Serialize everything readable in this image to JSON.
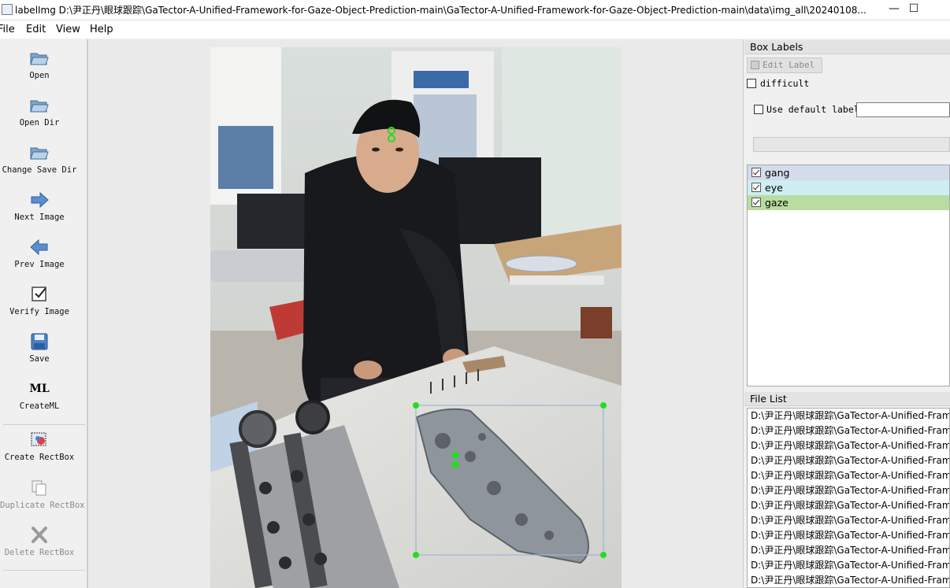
{
  "window": {
    "title": "labelImg D:\\尹正丹\\眼球跟踪\\GaTector-A-Unified-Framework-for-Gaze-Object-Prediction-main\\GaTector-A-Unified-Framework-for-Gaze-Object-Prediction-main\\data\\img_all\\20240108...",
    "minimize_glyph": "—",
    "maximize_glyph": "☐"
  },
  "menu": {
    "file": "File",
    "edit": "Edit",
    "view": "View",
    "help": "Help"
  },
  "toolbar": {
    "open": "Open",
    "open_dir": "Open Dir",
    "change_save_dir": "Change Save Dir",
    "next_image": "Next Image",
    "prev_image": "Prev Image",
    "verify_image": "Verify Image",
    "save": "Save",
    "create_ml": "CreateML",
    "create_rectbox": "Create RectBox",
    "duplicate_rectbox": "Duplicate RectBox",
    "delete_rectbox": "Delete RectBox",
    "ml_glyph": "ML"
  },
  "box_labels": {
    "title": "Box Labels",
    "edit_label": "Edit Label",
    "difficult": "difficult",
    "use_default_label": "Use default label",
    "default_label_value": "",
    "labels": [
      {
        "name": "gang",
        "checked": true,
        "color": "#d2dcea"
      },
      {
        "name": "eye",
        "checked": true,
        "color": "#cdeef2"
      },
      {
        "name": "gaze",
        "checked": true,
        "color": "#b9dca0"
      }
    ]
  },
  "file_list": {
    "title": "File List",
    "files": [
      "D:\\尹正丹\\眼球跟踪\\GaTector-A-Unified-Fram",
      "D:\\尹正丹\\眼球跟踪\\GaTector-A-Unified-Fram",
      "D:\\尹正丹\\眼球跟踪\\GaTector-A-Unified-Fram",
      "D:\\尹正丹\\眼球跟踪\\GaTector-A-Unified-Fram",
      "D:\\尹正丹\\眼球跟踪\\GaTector-A-Unified-Fram",
      "D:\\尹正丹\\眼球跟踪\\GaTector-A-Unified-Fram",
      "D:\\尹正丹\\眼球跟踪\\GaTector-A-Unified-Fram",
      "D:\\尹正丹\\眼球跟踪\\GaTector-A-Unified-Fram",
      "D:\\尹正丹\\眼球跟踪\\GaTector-A-Unified-Fram",
      "D:\\尹正丹\\眼球跟踪\\GaTector-A-Unified-Fram",
      "D:\\尹正丹\\眼球跟踪\\GaTector-A-Unified-Fram",
      "D:\\尹正丹\\眼球跟踪\\GaTector-A-Unified-Fram"
    ]
  },
  "canvas": {
    "box_color": "#9ab8d4",
    "handle_color": "#22dd22"
  }
}
